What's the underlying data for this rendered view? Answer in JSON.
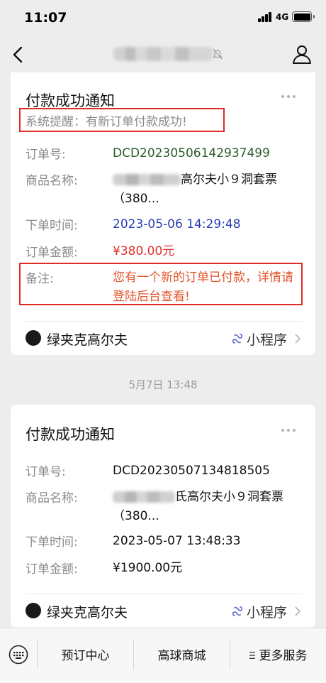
{
  "status_bar": {
    "time": "11:07",
    "network": "4G"
  },
  "nav": {
    "title": ""
  },
  "card1": {
    "title": "付款成功通知",
    "notice": "系统提醒：有新订单付款成功!",
    "order_no_label": "订单号:",
    "order_no": "DCD20230506142937499",
    "product_label": "商品名称:",
    "product_line1": "高尔夫小９洞套票",
    "product_line2": "（380...",
    "time_label": "下单时间:",
    "order_time": "2023-05-06 14:29:48",
    "amount_label": "订单金额:",
    "amount": "¥380.00元",
    "remark_label": "备注:",
    "remark": "您有一个新的订单已付款，详情请登陆后台查看!",
    "brand": "绿夹克高尔夫",
    "mini_program": "小程序"
  },
  "timestamp": "5月7日 13:48",
  "card2": {
    "title": "付款成功通知",
    "order_no_label": "订单号:",
    "order_no": "DCD20230507134818505",
    "product_label": "商品名称:",
    "product_line1": "氏高尔夫小９洞套票",
    "product_line2": "（380...",
    "time_label": "下单时间:",
    "order_time": "2023-05-07 13:48:33",
    "amount_label": "订单金额:",
    "amount": "¥1900.00元",
    "brand": "绿夹克高尔夫",
    "mini_program": "小程序"
  },
  "bottom_menu": {
    "item1": "预订中心",
    "item2": "高球商城",
    "item3": "更多服务"
  },
  "colors": {
    "order_no_green": "#2b5d2b",
    "time_blue": "#2a3fb7",
    "amount_red": "#e0312c",
    "remark_orange": "#e2542b",
    "highlight_box": "#e12a22"
  }
}
